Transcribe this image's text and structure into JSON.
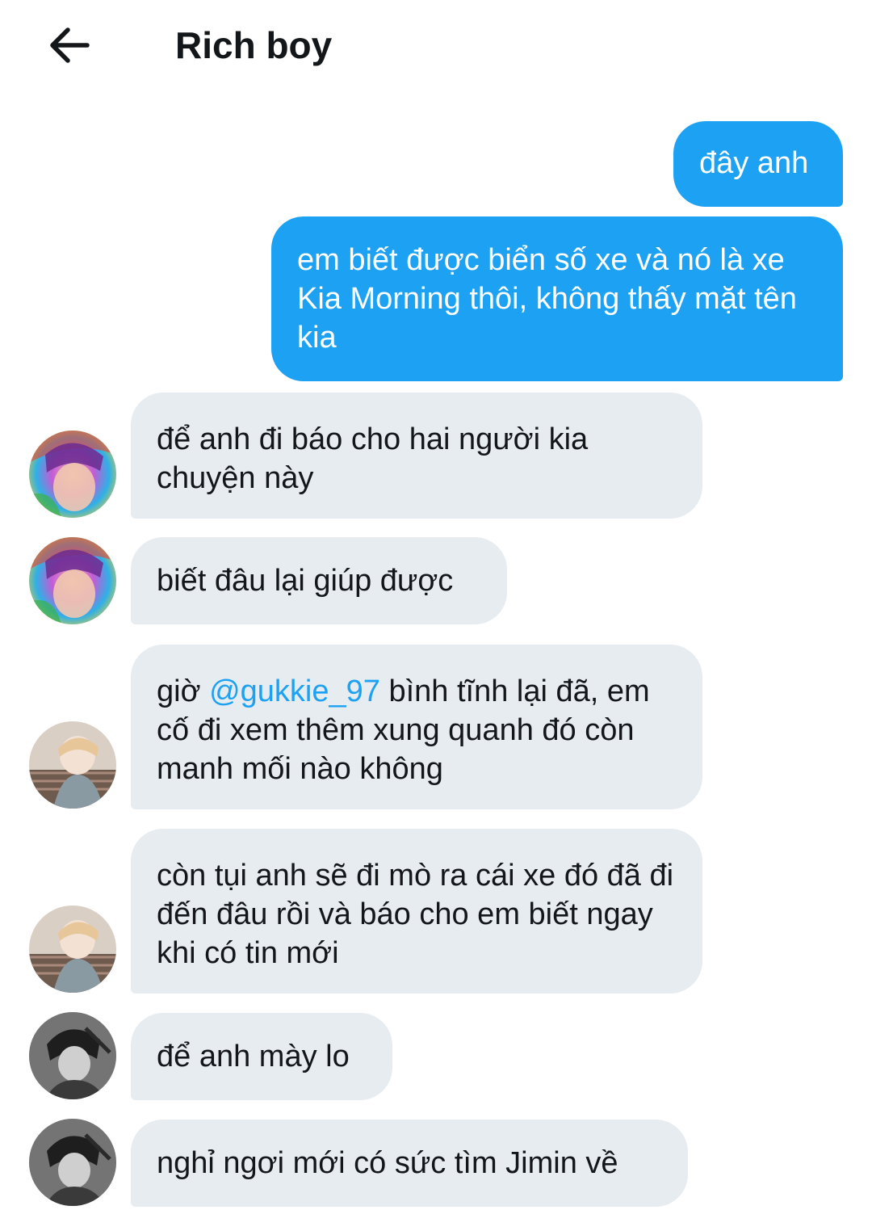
{
  "header": {
    "title": "Rich boy",
    "back_icon": "arrow-left-icon"
  },
  "colors": {
    "outgoing_bubble": "#1da1f2",
    "incoming_bubble": "#e7ecf0",
    "mention": "#1da1f2"
  },
  "messages": [
    {
      "direction": "outgoing",
      "text": "đây anh"
    },
    {
      "direction": "outgoing",
      "text": "em biết được biển số xe và nó là xe Kia Morning thôi, không thấy mặt tên kia"
    },
    {
      "direction": "incoming",
      "sender_avatar": "avatar-rainbow",
      "text": "để anh đi báo cho hai người kia chuyện này"
    },
    {
      "direction": "incoming",
      "sender_avatar": "avatar-rainbow",
      "text": "biết đâu lại giúp được"
    },
    {
      "direction": "incoming",
      "sender_avatar": "avatar-blonde",
      "text_before": "giờ ",
      "mention": "@gukkie_97",
      "text_after": " bình tĩnh lại đã, em cố đi xem thêm xung quanh đó còn manh mối nào không"
    },
    {
      "direction": "incoming",
      "sender_avatar": "avatar-blonde",
      "text": "còn tụi anh sẽ đi mò ra cái xe đó đã đi đến đâu rồi và báo cho em biết ngay khi có tin mới"
    },
    {
      "direction": "incoming",
      "sender_avatar": "avatar-dark",
      "text": "để anh mày lo"
    },
    {
      "direction": "incoming",
      "sender_avatar": "avatar-dark",
      "text": "nghỉ ngơi mới có sức tìm Jimin về"
    }
  ]
}
